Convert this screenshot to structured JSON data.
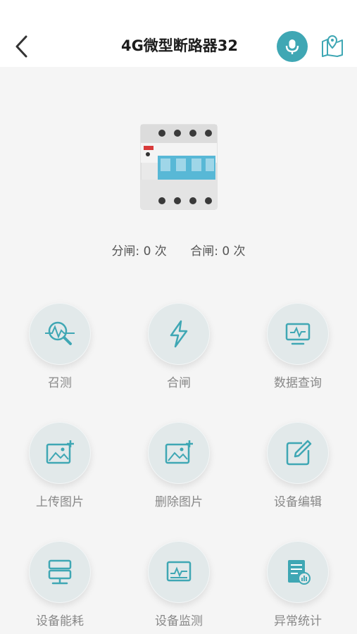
{
  "header": {
    "title": "4G微型断路器32"
  },
  "status": {
    "open_count": "分闸: 0 次",
    "close_count": "合闸: 0 次"
  },
  "actions": [
    {
      "label": "召测",
      "icon": "search-pulse-icon"
    },
    {
      "label": "合闸",
      "icon": "lightning-icon"
    },
    {
      "label": "数据查询",
      "icon": "monitor-pulse-icon"
    },
    {
      "label": "上传图片",
      "icon": "image-add-icon"
    },
    {
      "label": "删除图片",
      "icon": "image-add-icon"
    },
    {
      "label": "设备编辑",
      "icon": "edit-icon"
    },
    {
      "label": "设备能耗",
      "icon": "server-icon"
    },
    {
      "label": "设备监测",
      "icon": "monitor-chart-icon"
    },
    {
      "label": "异常统计",
      "icon": "report-icon"
    }
  ],
  "colors": {
    "accent": "#3fa7b4",
    "button_bg": "#e2e9ea"
  }
}
